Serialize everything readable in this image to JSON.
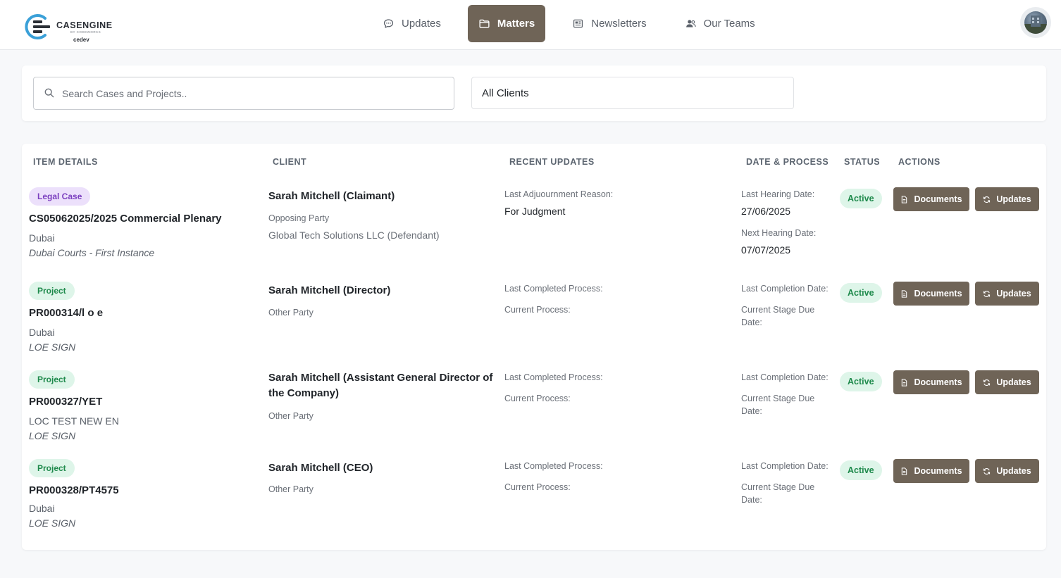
{
  "header": {
    "logo_text": "CASENGINE",
    "logo_sub": "BY CODEWORKS",
    "environment": "cedev",
    "nav": [
      {
        "label": "Updates",
        "icon": "chat-bubble-icon",
        "active": false
      },
      {
        "label": "Matters",
        "icon": "folder-icon",
        "active": true
      },
      {
        "label": "Newsletters",
        "icon": "newspaper-icon",
        "active": false
      },
      {
        "label": "Our Teams",
        "icon": "users-icon",
        "active": false
      }
    ],
    "avatar": "user-avatar"
  },
  "filters": {
    "search_placeholder": "Search Cases and Projects..",
    "search_value": "",
    "client_filter": "All Clients"
  },
  "table": {
    "headers": {
      "item_details": "ITEM DETAILS",
      "client": "CLIENT",
      "recent_updates": "RECENT UPDATES",
      "date_process": "DATE & PROCESS",
      "status": "STATUS",
      "actions": "ACTIONS"
    },
    "rows": [
      {
        "type": "Legal Case",
        "ref": "CS05062025/2025 Commercial Plenary",
        "location": "Dubai",
        "court": "Dubai Courts - First Instance",
        "client": "Sarah Mitchell (Claimant)",
        "party_label": "Opposing Party",
        "party_value": "Global Tech Solutions LLC (Defendant)",
        "update_label_1": "Last Adjuournment Reason:",
        "update_value_1": "For Judgment",
        "date_label_1": "Last Hearing Date:",
        "date_value_1": "27/06/2025",
        "date_label_2": "Next Hearing Date:",
        "date_value_2": "07/07/2025",
        "status": "Active",
        "documents_label": "Documents",
        "updates_label": "Updates"
      },
      {
        "type": "Project",
        "ref": "PR000314/l o e",
        "location": "Dubai",
        "court": "LOE SIGN",
        "client": "Sarah Mitchell (Director)",
        "party_label": "Other Party",
        "update_label_1": "Last Completed Process:",
        "update_label_2": "Current Process:",
        "date_label_1": "Last Completion Date:",
        "date_label_2": "Current Stage Due Date:",
        "status": "Active",
        "documents_label": "Documents",
        "updates_label": "Updates"
      },
      {
        "type": "Project",
        "ref": "PR000327/YET",
        "location": "LOC TEST NEW EN",
        "court": "LOE SIGN",
        "client": "Sarah Mitchell (Assistant General Director of the Company)",
        "party_label": "Other Party",
        "update_label_1": "Last Completed Process:",
        "update_label_2": "Current Process:",
        "date_label_1": "Last Completion Date:",
        "date_label_2": "Current Stage Due Date:",
        "status": "Active",
        "documents_label": "Documents",
        "updates_label": "Updates"
      },
      {
        "type": "Project",
        "ref": "PR000328/PT4575",
        "location": "Dubai",
        "court": "LOE SIGN",
        "client": "Sarah Mitchell (CEO)",
        "party_label": "Other Party",
        "update_label_1": "Last Completed Process:",
        "update_label_2": "Current Process:",
        "date_label_1": "Last Completion Date:",
        "date_label_2": "Current Stage Due Date:",
        "status": "Active",
        "documents_label": "Documents",
        "updates_label": "Updates"
      }
    ]
  },
  "colors": {
    "primary_button": "#6f6457",
    "legal_badge_bg": "#ece0fb",
    "legal_badge_text": "#7b3fbf",
    "project_badge_bg": "#def5e9",
    "project_badge_text": "#1f8a4c",
    "logo_accent": "#3aa0d8"
  }
}
